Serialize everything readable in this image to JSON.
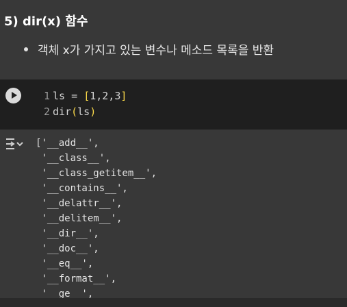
{
  "text_cell": {
    "heading": "5) dir(x) 함수",
    "bullet": "객체 x가 가지고 있는 변수나 메소드 목록을 반환"
  },
  "code_cell": {
    "line1": {
      "num": "1",
      "pre": "ls = ",
      "open": "[",
      "body": "1,2,3",
      "close": "]"
    },
    "line2": {
      "num": "2",
      "fn": "dir",
      "open": "(",
      "body": "ls",
      "close": ")"
    }
  },
  "output": {
    "lines": [
      "['__add__',",
      " '__class__',",
      " '__class_getitem__',",
      " '__contains__',",
      " '__delattr__',",
      " '__delitem__',",
      " '__dir__',",
      " '__doc__',",
      " '__eq__',",
      " '__format__',",
      " '__ge__',"
    ]
  },
  "icons": {
    "run": "play-circle-icon",
    "output_toggle": "output-collapse-icon"
  }
}
